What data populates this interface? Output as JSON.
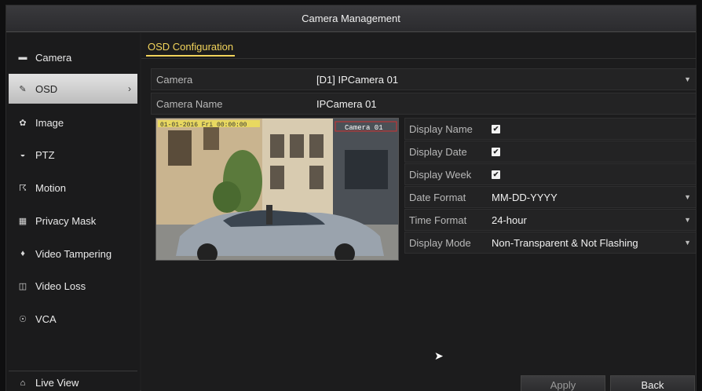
{
  "window": {
    "title": "Camera Management"
  },
  "sidebar": {
    "items": [
      {
        "label": "Camera",
        "icon": "camera-icon",
        "glyph": "▬"
      },
      {
        "label": "OSD",
        "icon": "osd-icon",
        "glyph": "✎"
      },
      {
        "label": "Image",
        "icon": "image-icon",
        "glyph": "✿"
      },
      {
        "label": "PTZ",
        "icon": "ptz-icon",
        "glyph": "◒"
      },
      {
        "label": "Motion",
        "icon": "motion-icon",
        "glyph": "☈"
      },
      {
        "label": "Privacy Mask",
        "icon": "privacy-mask-icon",
        "glyph": "▦"
      },
      {
        "label": "Video Tampering",
        "icon": "video-tampering-icon",
        "glyph": "♦"
      },
      {
        "label": "Video Loss",
        "icon": "video-loss-icon",
        "glyph": "◫"
      },
      {
        "label": "VCA",
        "icon": "vca-icon",
        "glyph": "☉"
      }
    ],
    "active_index": 1,
    "active_chevron": "›",
    "live_view": {
      "label": "Live View",
      "icon": "home-icon",
      "glyph": "⌂"
    }
  },
  "tab": {
    "label": "OSD Configuration"
  },
  "form": {
    "camera": {
      "label": "Camera",
      "value": "[D1] IPCamera 01"
    },
    "camera_name": {
      "label": "Camera Name",
      "value": "IPCamera 01"
    }
  },
  "preview": {
    "overlay_date": "01-01-2016 Fri 00:00:00",
    "overlay_name": "Camera 01"
  },
  "osd": {
    "display_name": {
      "label": "Display Name",
      "checked": true
    },
    "display_date": {
      "label": "Display Date",
      "checked": true
    },
    "display_week": {
      "label": "Display Week",
      "checked": true
    },
    "date_format": {
      "label": "Date Format",
      "value": "MM-DD-YYYY"
    },
    "time_format": {
      "label": "Time Format",
      "value": "24-hour"
    },
    "display_mode": {
      "label": "Display Mode",
      "value": "Non-Transparent & Not Flashing"
    }
  },
  "buttons": {
    "apply": "Apply",
    "back": "Back"
  },
  "colors": {
    "accent": "#f2d45b",
    "background": "#1c1c1d",
    "active_item": "#d0d0d0"
  }
}
